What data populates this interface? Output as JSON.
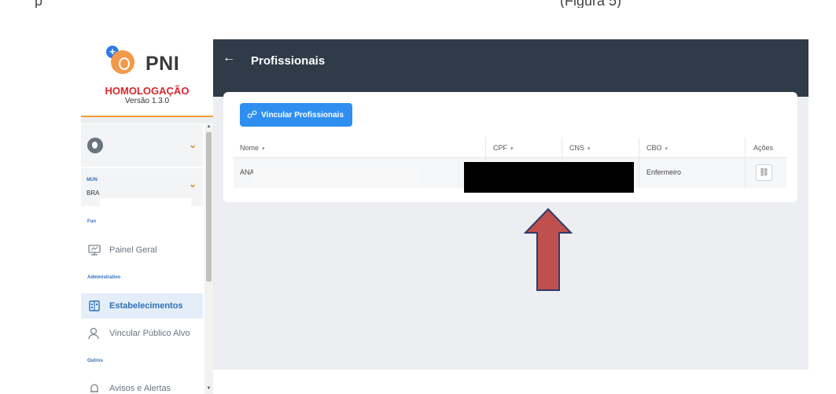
{
  "sidebar": {
    "logo_text": "PNI",
    "environment": "HOMOLOGAÇÃO",
    "version": "Versão 1.3.0",
    "municipality_label": "MUN",
    "municipality_value": "BRA",
    "sections": {
      "functions_label": "Fun",
      "admin_label": "Administrativo",
      "others_label": "Outros"
    },
    "items": [
      {
        "label": "Painel Geral",
        "icon": "monitor-icon"
      },
      {
        "label": "Estabelecimentos",
        "icon": "building-icon",
        "active": true
      },
      {
        "label": "Vincular Público Alvo",
        "icon": "user-icon"
      },
      {
        "label": "Avisos e Alertas",
        "icon": "bell-icon"
      }
    ]
  },
  "header": {
    "back_icon": "arrow-left-icon",
    "title": "Profissionais"
  },
  "toolbar": {
    "link_button_label": "Vincular Profissionais",
    "link_button_icon": "link-icon"
  },
  "table": {
    "columns": [
      "Nome",
      "CPF",
      "CNS",
      "CBO",
      "Ações"
    ],
    "sort_indicator": "▾",
    "rows": [
      {
        "nome": "ANA /",
        "cpf": "",
        "cns": "",
        "cbo": "Enfermeiro",
        "action_icon": "unlink-icon"
      }
    ]
  },
  "colors": {
    "header_bg": "#2f3b48",
    "primary_button": "#2f8ff0",
    "environment_red": "#d8262c",
    "accent_orange": "#f39c33",
    "arrow_fill": "#c0504d",
    "arrow_stroke": "#2f3b6b"
  },
  "top_text": {
    "left": "p",
    "right": "(Figura 5)"
  }
}
